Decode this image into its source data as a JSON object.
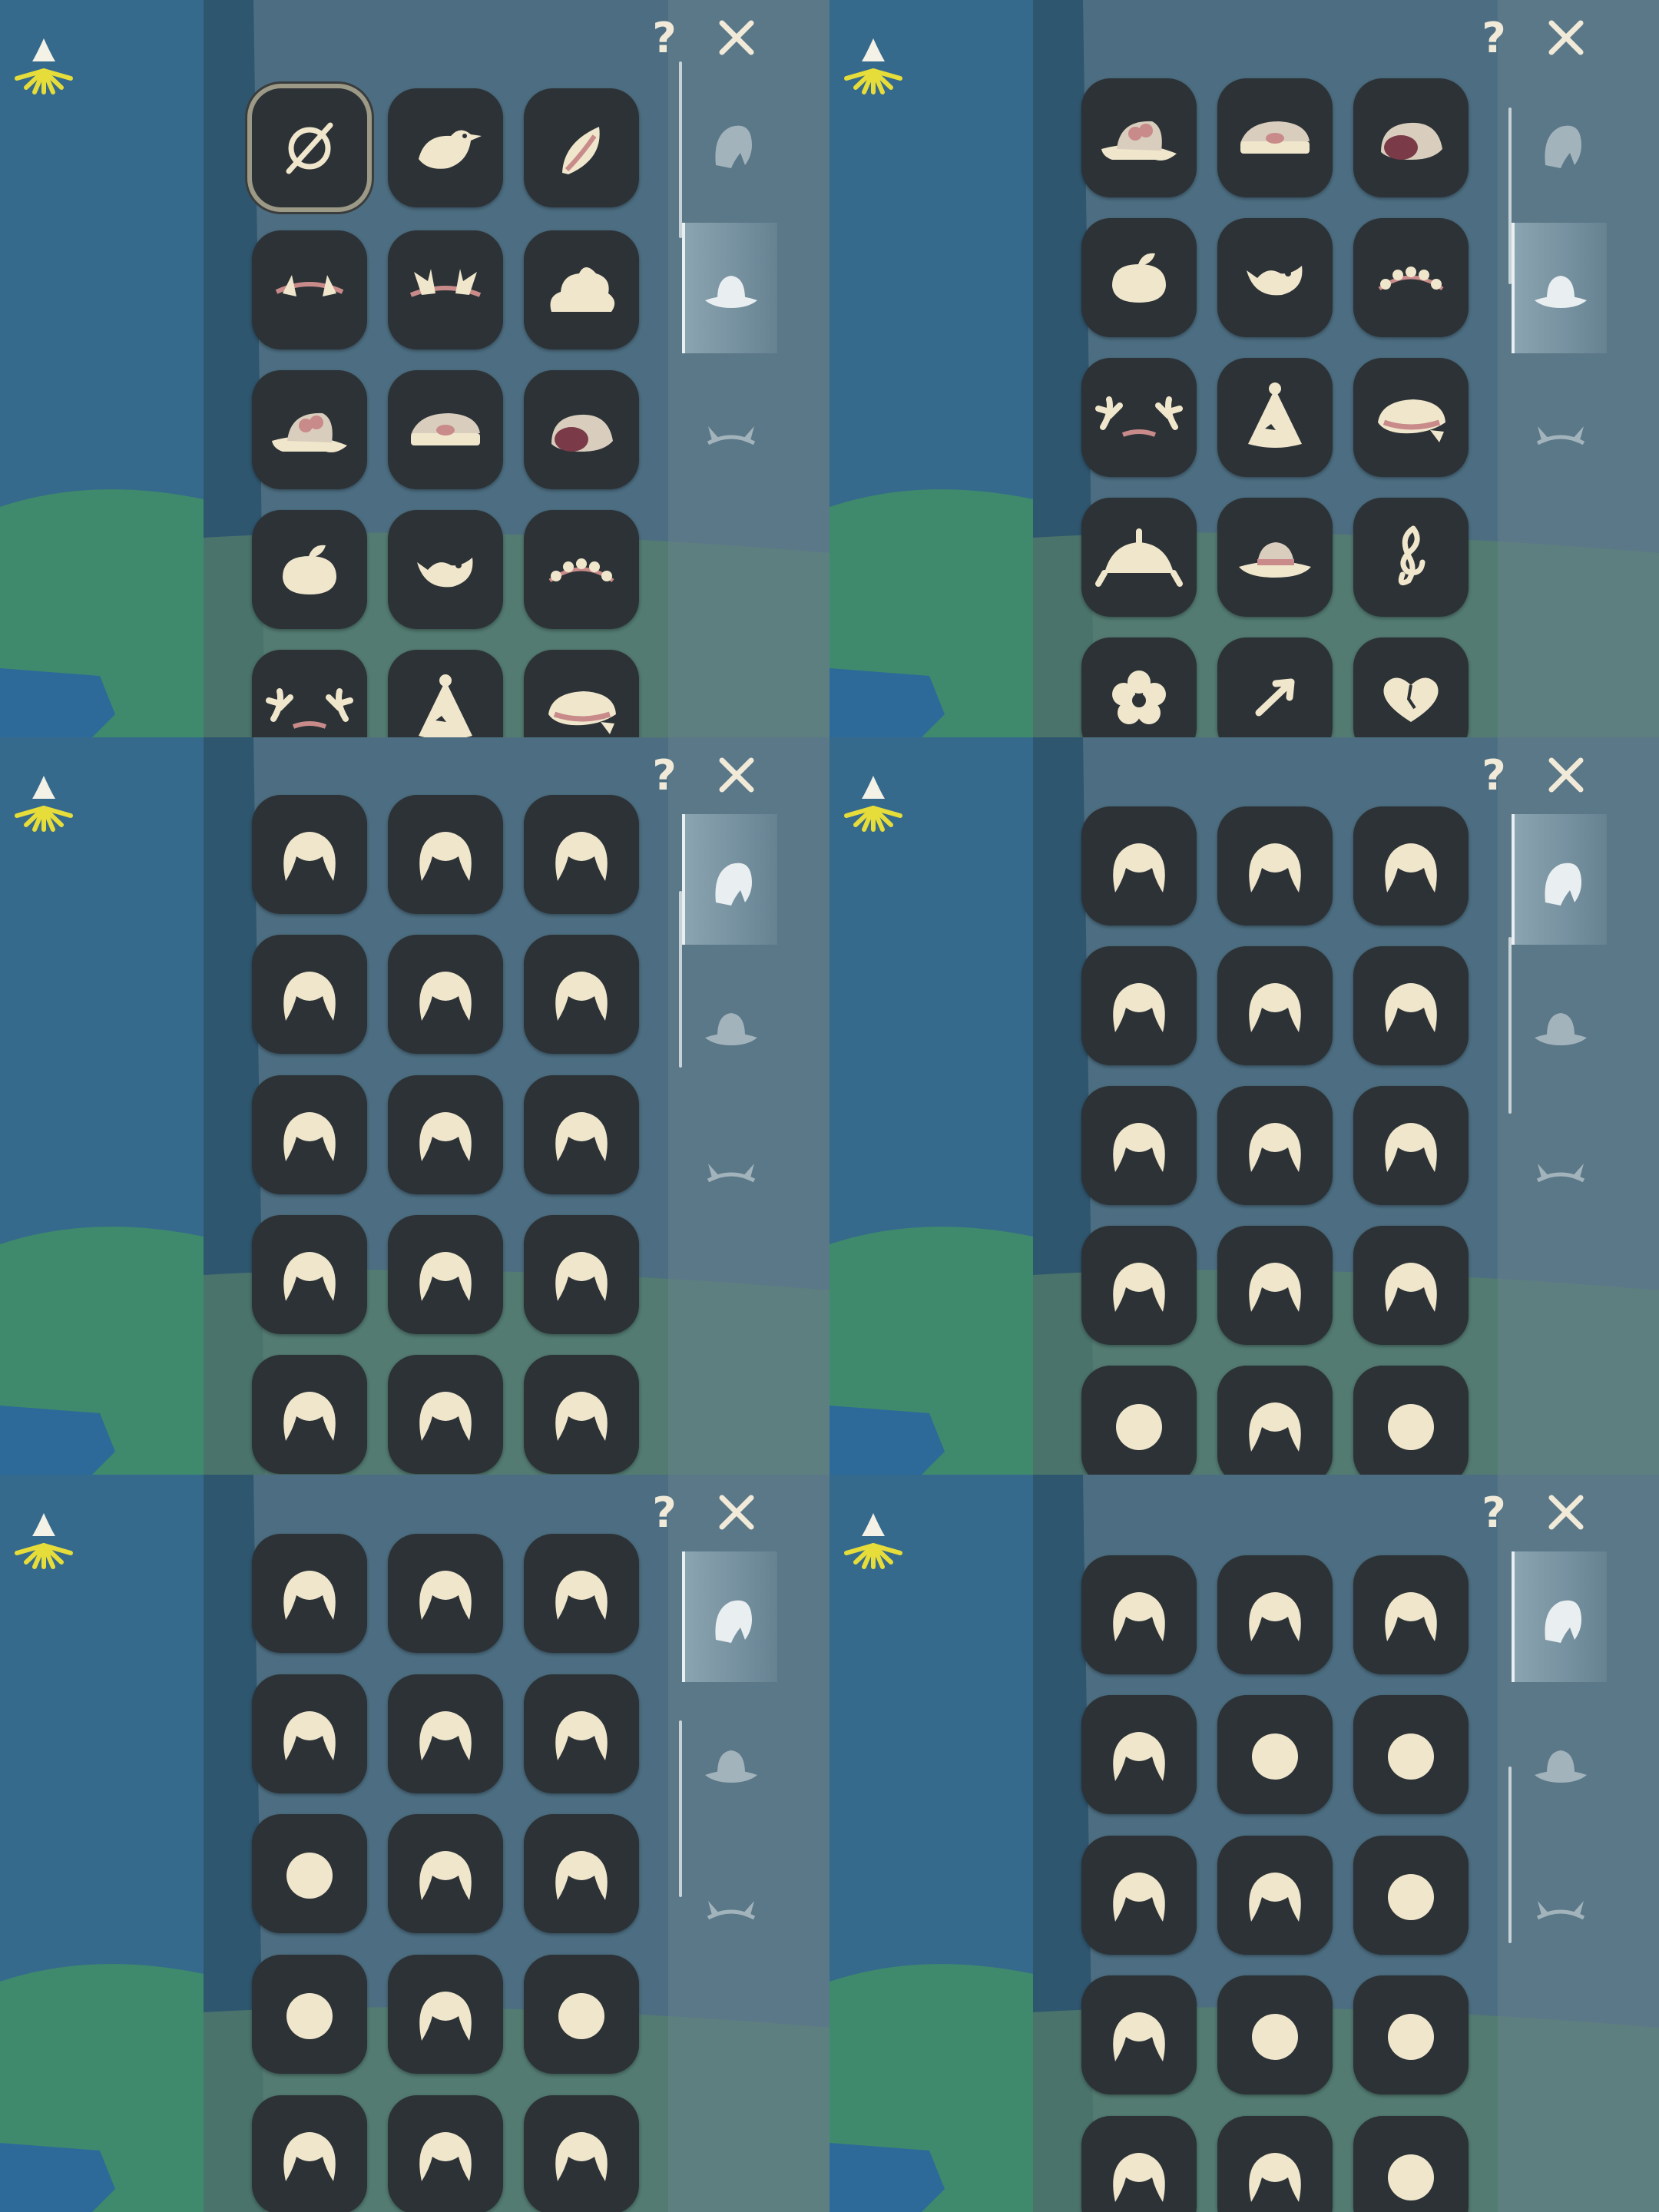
{
  "ui": {
    "help_label": "?",
    "accent": "#efe6cc",
    "tile_color": "#2c3236",
    "badge_color": "#d8b24a",
    "top_icon": "wing-light-icon",
    "tabs": [
      {
        "name": "hair-tab",
        "icon": "hair-icon"
      },
      {
        "name": "hat-tab",
        "icon": "hat-icon"
      },
      {
        "name": "horn-tab",
        "icon": "horn-icon"
      }
    ]
  },
  "panels": [
    {
      "active_tab": 1,
      "selected": 0,
      "rows": [
        [
          "none-icon",
          "bird-hat-icon",
          "leaf-petal-icon"
        ],
        [
          "small-horns-icon",
          "antler-horns-icon",
          "cloud-hat-icon"
        ],
        [
          "bow-sunhat-icon",
          "officer-cap-icon",
          "bread-hat-icon"
        ],
        [
          "peach-hat-icon",
          "fish-hat-icon",
          "flower-crown-icon"
        ],
        [
          "branch-antlers-icon",
          "party-cone-icon",
          "beret-icon"
        ]
      ]
    },
    {
      "active_tab": 1,
      "selected": -1,
      "rows": [
        [
          "bow-sunhat-icon",
          "officer-cap-icon",
          "bread-hat-icon"
        ],
        [
          "peach-hat-icon",
          "fish-hat-icon",
          "flower-crown-icon"
        ],
        [
          "branch-antlers-icon",
          "party-cone-icon",
          "beret-icon"
        ],
        [
          "jester-hat-icon",
          "ribbon-hat-icon",
          "music-clef-icon"
        ],
        [
          "flower-icon",
          "arrow-icon",
          "heart-icon"
        ]
      ]
    },
    {
      "active_tab": 0,
      "selected": -1,
      "rows": [
        [
          "short-hair-icon",
          "swept-hair-icon",
          "side-tail-icon"
        ],
        [
          "wavy-hair-icon",
          "long-hair-icon",
          "bangs-hair-icon"
        ],
        [
          "flowing-hair-icon",
          "spiky-hair-icon",
          "curly-hair-icon"
        ],
        [
          "afro-hair-icon",
          "bun-hair-icon",
          "twin-buns-icon"
        ],
        [
          "bob-hair-icon",
          "wing-hair-icon",
          "braided-hair-icon"
        ]
      ]
    },
    {
      "active_tab": 0,
      "selected": -1,
      "rows": [
        [
          "fish-hair-icon",
          "peak-hair-icon",
          "swirl-tail-icon"
        ],
        [
          "hood-hair-icon",
          "cone-hair-icon",
          "cat-ears-hair-icon"
        ],
        [
          "curly-bob-icon",
          "double-bun-icon",
          "pigtails-icon"
        ],
        [
          "braids-icon",
          "mushroom-hair-icon",
          "ponytail-icon"
        ],
        [
          "straw-hat-icon",
          "bun-braid-icon",
          "saucer-hat-icon"
        ]
      ]
    },
    {
      "active_tab": 0,
      "selected": -1,
      "rows": [
        [
          "cap-hair-icon",
          "crown-braid-icon",
          "fluffy-bun-icon"
        ],
        [
          "messy-hair-icon",
          "loop-braids-icon",
          "headband-hair-icon"
        ],
        [
          "wave-long-icon",
          "elf-hat-hair-icon",
          "twin-tails-icon"
        ],
        [
          "fluffy-short-icon",
          "feather-hair-icon",
          "long-wavy-icon"
        ],
        [
          "side-braid-icon",
          "helmet-hair-icon",
          "pointy-hair-icon"
        ]
      ]
    },
    {
      "active_tab": 0,
      "selected": -1,
      "rows": [
        [
          "round-hood-icon",
          "cat-hood-icon",
          "veil-hair-icon"
        ],
        [
          "puffy-pigtails-icon",
          "ribbon-long-icon",
          "dark-twin-icon"
        ],
        [
          "dark-bun-icon",
          "dark-hood-icon",
          "lion-mask-icon"
        ],
        [
          "pigtail-bob-icon",
          "pumpkin-icon",
          "witch-hat-icon"
        ],
        [
          "fox-hood-icon",
          "bunny-ears-icon",
          "ring-icon"
        ]
      ]
    }
  ]
}
